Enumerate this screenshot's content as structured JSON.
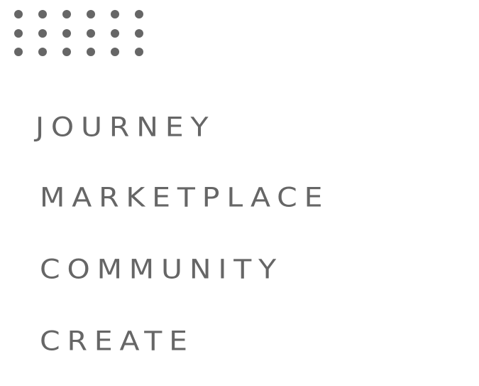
{
  "menu": {
    "icon": "grid-dots-icon",
    "text_color": "#666666",
    "items": [
      {
        "label": "JOURNEY"
      },
      {
        "label": "MARKETPLACE"
      },
      {
        "label": "COMMUNITY"
      },
      {
        "label": "CREATE"
      }
    ]
  }
}
